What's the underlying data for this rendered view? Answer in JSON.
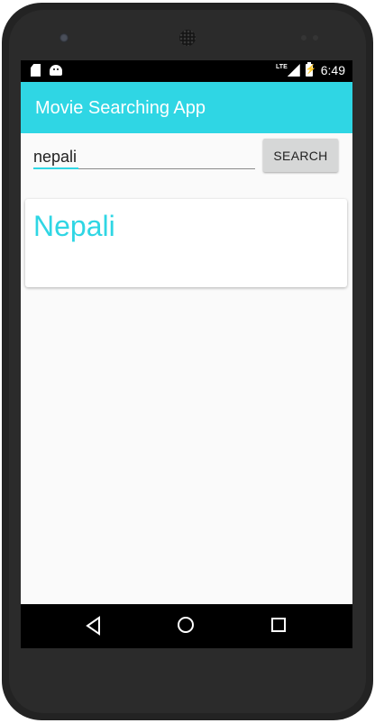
{
  "status_bar": {
    "time": "6:49",
    "network": "LTE",
    "icons": [
      "sd-card-icon",
      "android-debug-icon",
      "signal-icon",
      "battery-charging-icon"
    ]
  },
  "app_bar": {
    "title": "Movie Searching App"
  },
  "search": {
    "value": "nepali",
    "button_label": "SEARCH"
  },
  "results": [
    {
      "title": "Nepali"
    }
  ],
  "nav_bar": {
    "icons": [
      "back-icon",
      "home-icon",
      "recents-icon"
    ]
  },
  "colors": {
    "accent": "#2fd6e4",
    "background": "#fafafa",
    "button": "#d6d7d7"
  }
}
